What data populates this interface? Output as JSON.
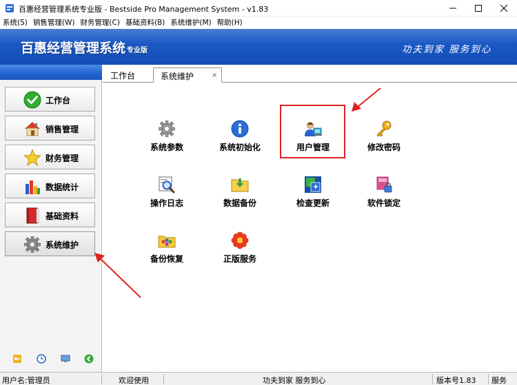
{
  "window": {
    "title": "百惠经营管理系统专业版 - Bestside Pro Management System - v1.83"
  },
  "menu": [
    {
      "label": "系统(S)"
    },
    {
      "label": "销售管理(W)"
    },
    {
      "label": "财务管理(C)"
    },
    {
      "label": "基础资料(B)"
    },
    {
      "label": "系统维护(M)"
    },
    {
      "label": "帮助(H)"
    }
  ],
  "banner": {
    "brand": "百惠经营管理系统",
    "brand_sub": "专业版",
    "slogan": "功夫到家 服务到心"
  },
  "sidebar": {
    "items": [
      {
        "label": "工作台",
        "icon": "check-icon"
      },
      {
        "label": "销售管理",
        "icon": "house-icon"
      },
      {
        "label": "财务管理",
        "icon": "star-icon"
      },
      {
        "label": "数据统计",
        "icon": "bar-chart-icon"
      },
      {
        "label": "基础资料",
        "icon": "book-icon"
      },
      {
        "label": "系统维护",
        "icon": "gear-icon"
      }
    ],
    "bottom_icons": [
      "key-icon",
      "clock-icon",
      "monitor-icon",
      "back-arrow-icon"
    ]
  },
  "tabs": [
    {
      "label": "工作台"
    },
    {
      "label": "系统维护",
      "close": "×"
    }
  ],
  "tiles": [
    {
      "label": "系统参数",
      "icon": "gear-icon"
    },
    {
      "label": "系统初始化",
      "icon": "info-icon"
    },
    {
      "label": "用户管理",
      "icon": "user-icon"
    },
    {
      "label": "修改密码",
      "icon": "key-icon"
    },
    {
      "label": "操作日志",
      "icon": "search-log-icon"
    },
    {
      "label": "数据备份",
      "icon": "folder-backup-icon"
    },
    {
      "label": "检查更新",
      "icon": "update-icon"
    },
    {
      "label": "软件锁定",
      "icon": "lock-icon"
    },
    {
      "label": "备份恢复",
      "icon": "restore-icon"
    },
    {
      "label": "正版服务",
      "icon": "flower-icon"
    }
  ],
  "status": {
    "user": "用户名:管理员",
    "welcome": "欢迎使用",
    "slogan": "功夫到家 服务到心",
    "version": "版本号1.83",
    "service": "服务"
  },
  "colors": {
    "banner": "#1a58c4",
    "highlight": "#e02020",
    "arrow": "#e02020"
  }
}
